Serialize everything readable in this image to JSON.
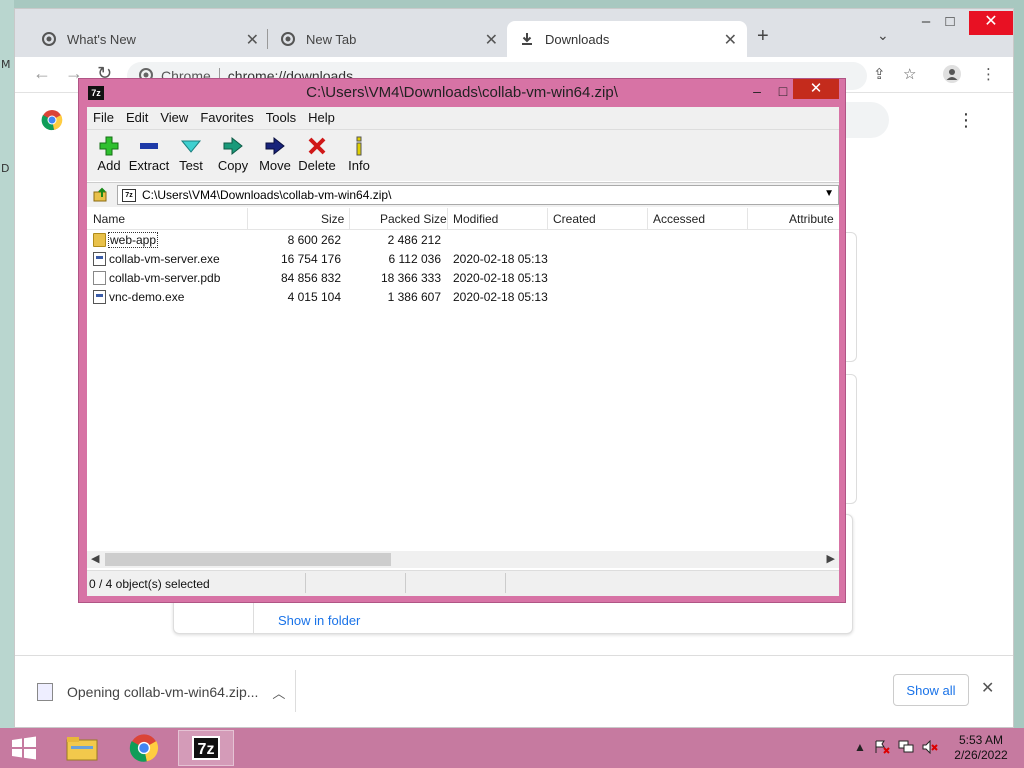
{
  "desktop": {
    "marks": [
      "M",
      "D"
    ]
  },
  "browser": {
    "tabs": [
      {
        "label": "What's New"
      },
      {
        "label": "New Tab"
      },
      {
        "label": "Downloads"
      }
    ],
    "omnibox": {
      "scheme_label": "Chrome",
      "url": "chrome://downloads"
    },
    "download_card": {
      "show_in_folder": "Show in folder"
    },
    "shelf": {
      "item_label": "Opening collab-vm-win64.zip...",
      "show_all": "Show all"
    }
  },
  "sevenzip": {
    "title": "C:\\Users\\VM4\\Downloads\\collab-vm-win64.zip\\",
    "logo": "7z",
    "menu": [
      "File",
      "Edit",
      "View",
      "Favorites",
      "Tools",
      "Help"
    ],
    "tools": [
      "Add",
      "Extract",
      "Test",
      "Copy",
      "Move",
      "Delete",
      "Info"
    ],
    "address": "C:\\Users\\VM4\\Downloads\\collab-vm-win64.zip\\",
    "columns": [
      "Name",
      "Size",
      "Packed Size",
      "Modified",
      "Created",
      "Accessed",
      "Attribute"
    ],
    "rows": [
      {
        "name": "web-app",
        "size": "8 600 262",
        "packed": "2 486 212",
        "modified": ""
      },
      {
        "name": "collab-vm-server.exe",
        "size": "16 754 176",
        "packed": "6 112 036",
        "modified": "2020-02-18 05:13"
      },
      {
        "name": "collab-vm-server.pdb",
        "size": "84 856 832",
        "packed": "18 366 333",
        "modified": "2020-02-18 05:13"
      },
      {
        "name": "vnc-demo.exe",
        "size": "4 015 104",
        "packed": "1 386 607",
        "modified": "2020-02-18 05:13"
      }
    ],
    "status": "0 / 4 object(s) selected"
  },
  "taskbar": {
    "time": "5:53 AM",
    "date": "2/26/2022",
    "app_7z_label": "7z"
  }
}
